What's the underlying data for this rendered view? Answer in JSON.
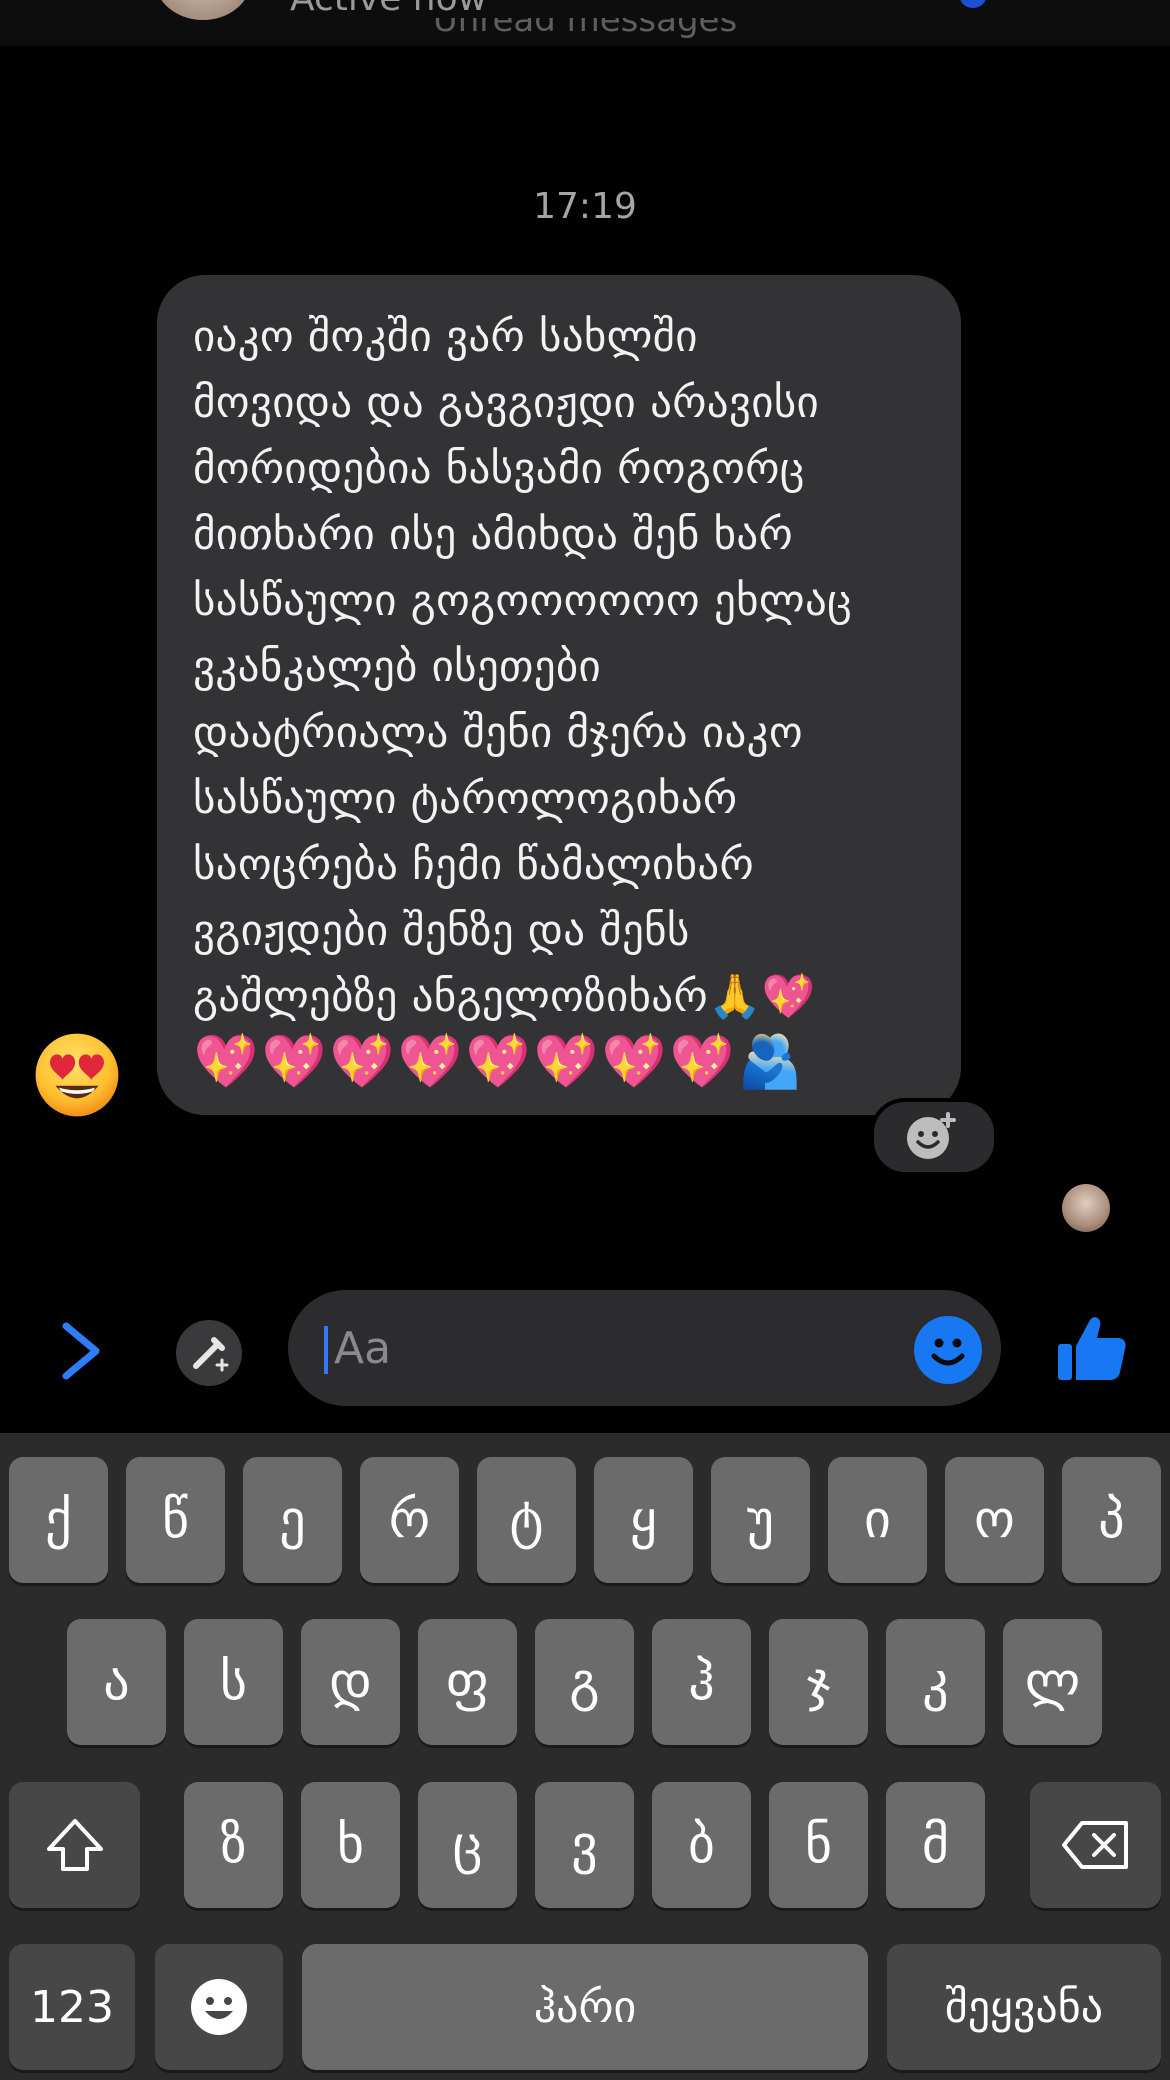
{
  "header": {
    "status": "Active now",
    "unread_banner": "Unread messages"
  },
  "conversation": {
    "timestamp": "17:19",
    "message_text": "იაკო შოკში ვარ სახლში\nმოვიდა და გავგიჟდი არავისი\nმორიდებია ნასვამი როგორც\nმითხარი ისე ამიხდა შენ ხარ\nსასწაული გოგოოოოოო ეხლაც\nვკანკალებ ისეთები\nდაატრიალა შენი მჯერა იაკო\nსასწაული ტაროლოგიხარ\nსაოცრება ჩემი წამალიხარ\nვგიჟდები შენზე და შენს\nგაშლებზე ანგელოზიხარ🙏💖",
    "emoji_row": [
      "💖",
      "💖",
      "💖",
      "💖",
      "💖",
      "💖",
      "💖",
      "💖",
      "🫂"
    ],
    "reaction": "😍"
  },
  "composer": {
    "placeholder": "Aa"
  },
  "keyboard": {
    "row1": [
      "ქ",
      "წ",
      "ე",
      "რ",
      "ტ",
      "ყ",
      "უ",
      "ი",
      "ო",
      "პ"
    ],
    "row2": [
      "ა",
      "ს",
      "დ",
      "ფ",
      "გ",
      "ჰ",
      "ჯ",
      "კ",
      "ლ"
    ],
    "row3": [
      "ზ",
      "ხ",
      "ც",
      "ვ",
      "ბ",
      "ნ",
      "მ"
    ],
    "numbers_label": "123",
    "space_label": "ჰარი",
    "return_label": "შეყვანა"
  },
  "colors": {
    "accent": "#1877f2",
    "bubble": "#333335",
    "heart": "#ff3fa4"
  }
}
